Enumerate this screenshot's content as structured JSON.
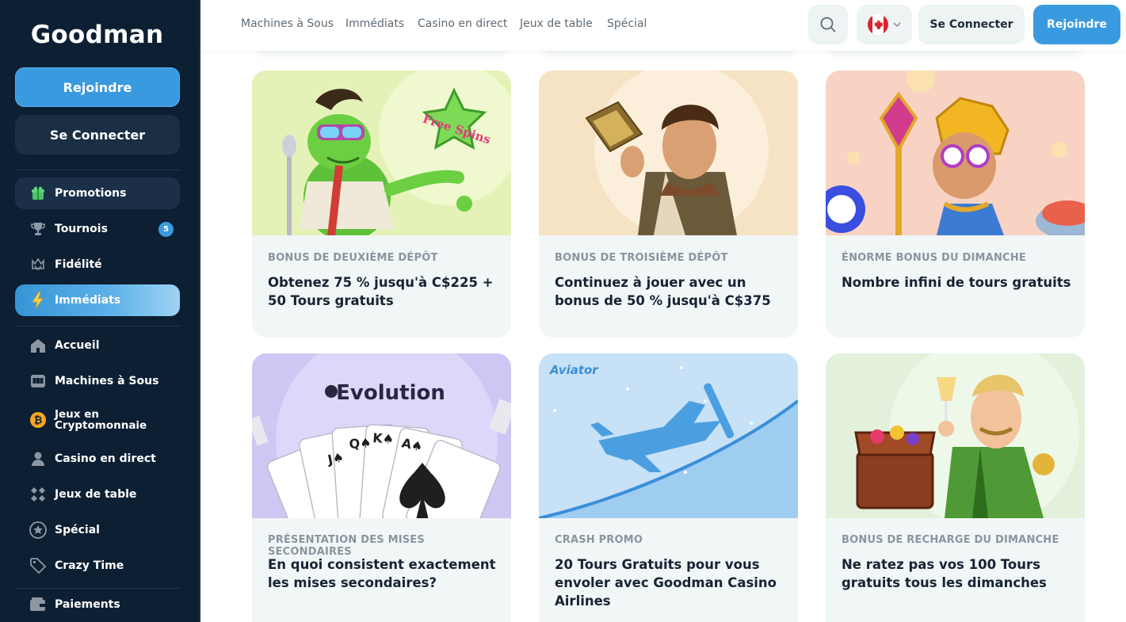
{
  "brand": {
    "logo": "Goodman"
  },
  "sidebar": {
    "join_label": "Rejoindre",
    "login_label": "Se Connecter",
    "items": [
      {
        "label": "Promotions",
        "icon": "gift-icon"
      },
      {
        "label": "Tournois",
        "icon": "trophy-icon",
        "badge": "5"
      },
      {
        "label": "Fidélité",
        "icon": "loyalty-icon"
      },
      {
        "label": "Immédiats",
        "icon": "lightning-icon"
      },
      {
        "label": "Accueil",
        "icon": "home-icon"
      },
      {
        "label": "Machines à Sous",
        "icon": "slot-machine-icon"
      },
      {
        "label": "Jeux en Cryptomonnaie",
        "icon": "bitcoin-icon"
      },
      {
        "label": "Casino en direct",
        "icon": "live-dealer-icon"
      },
      {
        "label": "Jeux de table",
        "icon": "table-games-icon"
      },
      {
        "label": "Spécial",
        "icon": "star-icon"
      },
      {
        "label": "Crazy Time",
        "icon": "tag-icon"
      },
      {
        "label": "Paiements",
        "icon": "wallet-icon"
      }
    ]
  },
  "topnav": {
    "links": [
      "Machines à Sous",
      "Immédiats",
      "Casino en direct",
      "Jeux de table",
      "Spécial"
    ],
    "login_label": "Se Connecter",
    "join_label": "Rejoindre",
    "language_flag": "canada-flag-icon"
  },
  "promotions": [
    {
      "category": "BONUS DE DEUXIÈME DÉPÔT",
      "title": "Obtenez 75 % jusqu'à C$225 + 50 Tours gratuits",
      "art_text": "Free Spins",
      "bg": "#e4f2b8"
    },
    {
      "category": "BONUS DE TROISIÈME DÉPÔT",
      "title": "Continuez à jouer avec un bonus de 50 % jusqu'à C$375",
      "bg": "#f6e3c4"
    },
    {
      "category": "ÉNORME BONUS DU DIMANCHE",
      "title": "Nombre infini de tours gratuits",
      "bg": "#f8d3c3"
    },
    {
      "category": "PRÉSENTATION DES MISES SECONDAIRES",
      "title": "En quoi consistent exactement les mises secondaires?",
      "art_text": "Evolution",
      "bg": "#cfc6f4"
    },
    {
      "category": "CRASH PROMO",
      "title": "20 Tours Gratuits pour vous envoler avec Goodman Casino Airlines",
      "art_text": "Aviator",
      "bg": "#c7e1f7"
    },
    {
      "category": "BONUS DE RECHARGE DU DIMANCHE",
      "title": "Ne ratez pas vos 100 Tours gratuits tous les dimanches",
      "bg": "#e3f1dc"
    }
  ],
  "colors": {
    "sidebar_bg": "#0d1f33",
    "accent": "#3a9ae0",
    "card_bg": "#f1f6f7",
    "text_dark": "#162332",
    "text_muted": "#8a959e"
  }
}
